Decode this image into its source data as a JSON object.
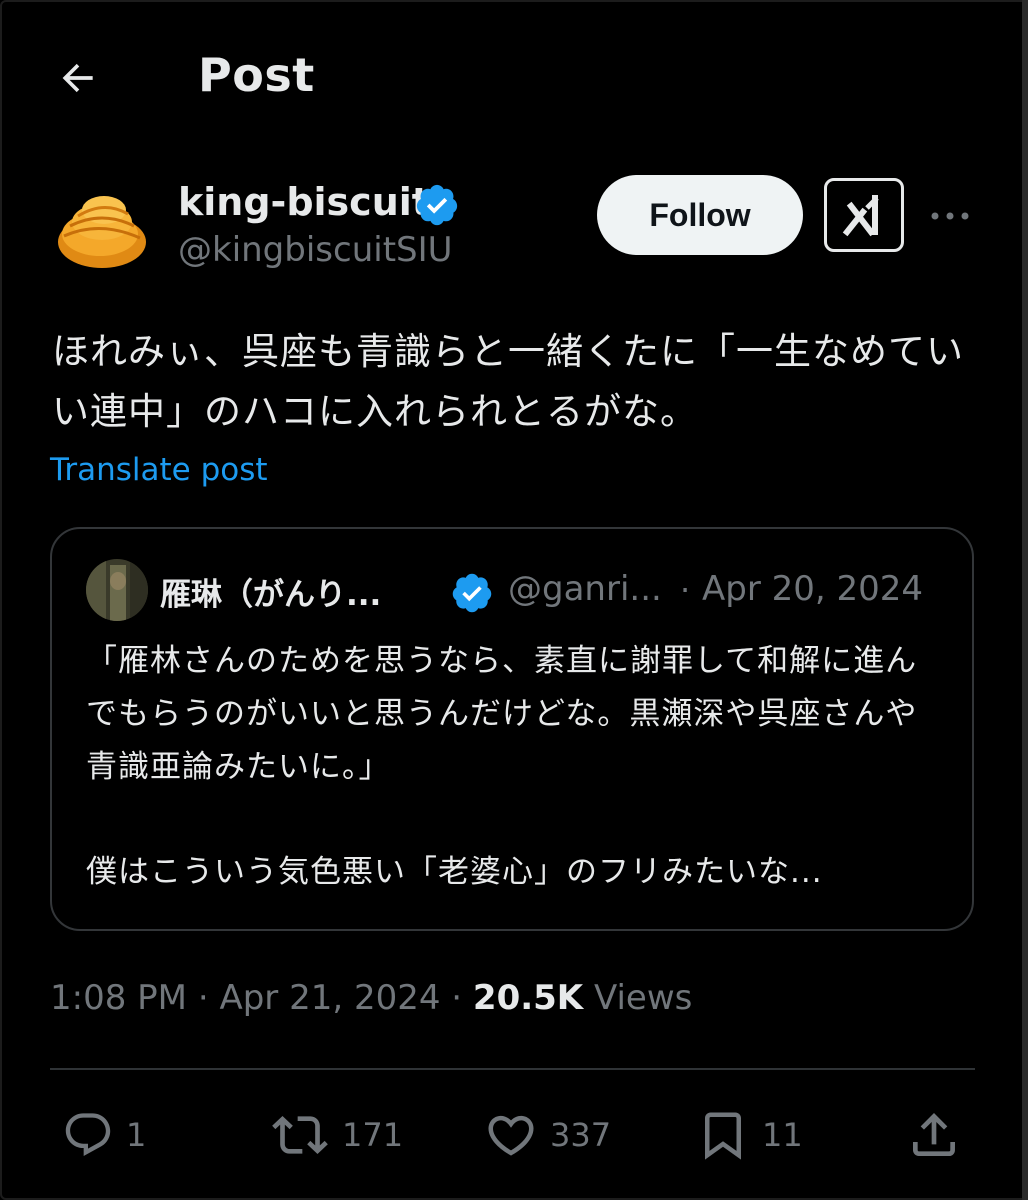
{
  "header": {
    "title": "Post"
  },
  "author": {
    "display_name": "king-biscuit",
    "handle": "@kingbiscuitSIU",
    "follow_label": "Follow"
  },
  "post": {
    "text": "ほれみぃ、呉座も青識らと一緒くたに「一生なめていい連中」のハコに入れられとるがな。",
    "translate_label": "Translate post",
    "time": "1:08 PM",
    "date": "Apr 21, 2024",
    "views_count": "20.5K",
    "views_label": "Views"
  },
  "quote": {
    "display_name": "雁琳（がんり...",
    "handle": "@ganri...",
    "separator": "·",
    "date": "Apr 20, 2024",
    "paragraph1": "「雁林さんのためを思うなら、素直に謝罪して和解に進んでもらうのがいいと思うんだけどな。黒瀬深や呉座さんや青識亜論みたいに。」",
    "paragraph2": "僕はこういう気色悪い「老婆心」のフリみたいな..."
  },
  "actions": {
    "replies": "1",
    "reposts": "171",
    "likes": "337",
    "bookmarks": "11"
  },
  "colors": {
    "background": "#000000",
    "text": "#e7e9ea",
    "muted": "#71767b",
    "accent": "#1d9bf0",
    "border": "#333639"
  },
  "icons": [
    "back-arrow-icon",
    "verified-badge-icon",
    "grok-icon",
    "more-icon",
    "reply-icon",
    "repost-icon",
    "like-icon",
    "bookmark-icon",
    "share-icon"
  ]
}
